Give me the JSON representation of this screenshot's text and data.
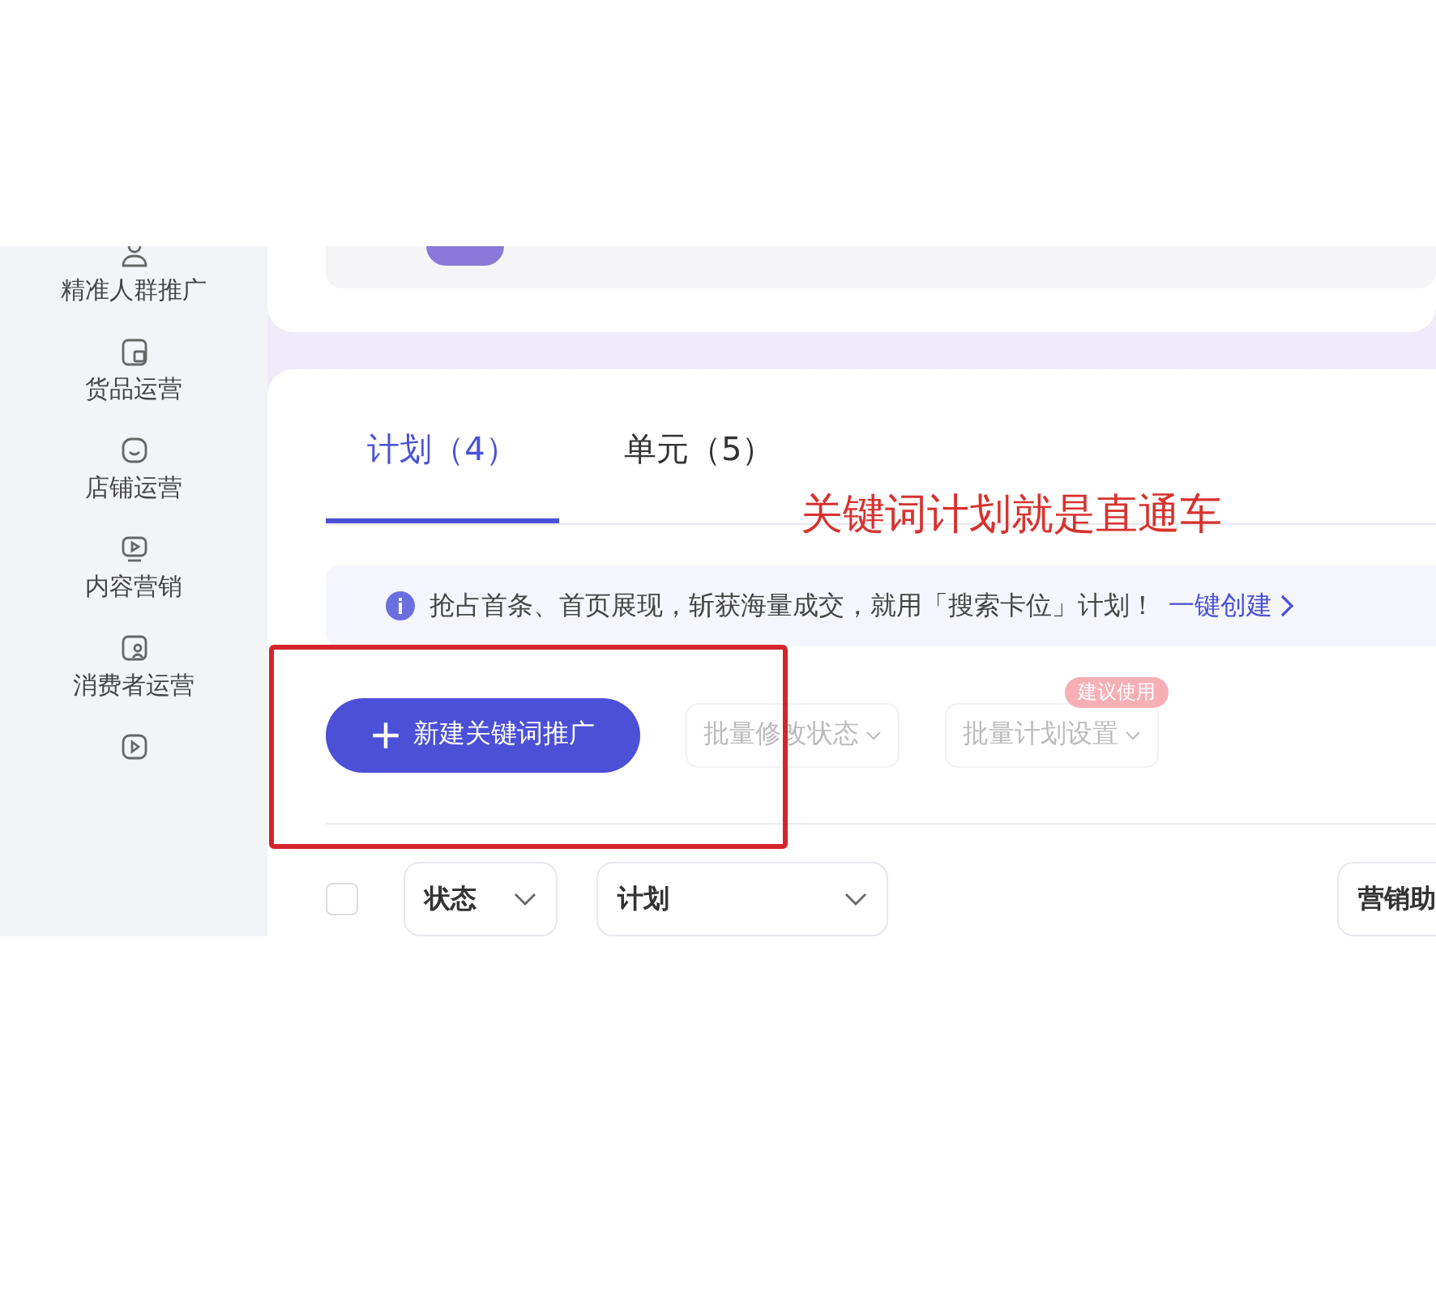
{
  "sidebar": {
    "items": [
      {
        "label": "精准人群推广"
      },
      {
        "label": "货品运营"
      },
      {
        "label": "店铺运营"
      },
      {
        "label": "内容营销"
      },
      {
        "label": "消费者运营"
      }
    ]
  },
  "tabs": [
    {
      "label": "计划（4）",
      "selected": true
    },
    {
      "label": "单元（5）",
      "selected": false
    }
  ],
  "annotation": {
    "text": "关键词计划就是直通车"
  },
  "banner": {
    "text": "抢占首条、首页展现，斩获海量成交，就用「搜索卡位」计划！",
    "link": "一键创建"
  },
  "toolbar": {
    "primary_button": "新建关键词推广",
    "actions": [
      {
        "label": "批量修改状态",
        "disabled": true
      },
      {
        "label": "批量计划设置",
        "disabled": true,
        "badge": "建议使用"
      }
    ]
  },
  "filters": {
    "select_all_checked": false,
    "selects": [
      {
        "label": "状态"
      },
      {
        "label": "计划"
      }
    ],
    "cut_select": "营销助"
  }
}
